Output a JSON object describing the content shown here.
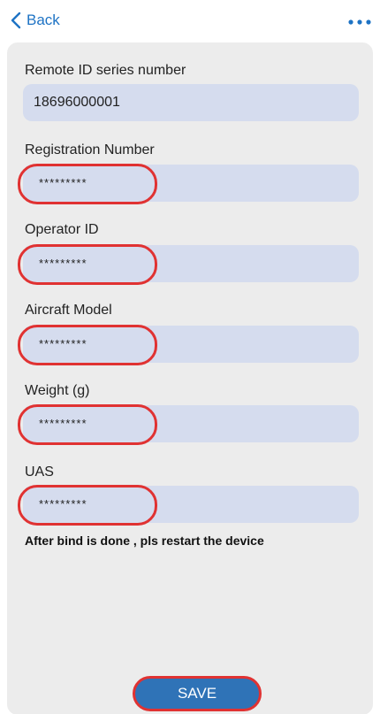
{
  "header": {
    "back_label": "Back",
    "more_icon": "more-icon"
  },
  "form": {
    "fields": [
      {
        "label": "Remote ID series number",
        "value": "18696000001"
      },
      {
        "label": "Registration Number",
        "value": "*********"
      },
      {
        "label": "Operator ID",
        "value": "*********"
      },
      {
        "label": "Aircraft Model",
        "value": "*********"
      },
      {
        "label": "Weight (g)",
        "value": "*********"
      },
      {
        "label": "UAS",
        "value": "*********"
      }
    ],
    "notice": "After bind is done , pls restart the device",
    "save_label": "SAVE"
  },
  "colors": {
    "accent": "#1e73c4",
    "highlight": "#e03232",
    "field_bg": "#d5dcee",
    "button_bg": "#2f73b7"
  }
}
